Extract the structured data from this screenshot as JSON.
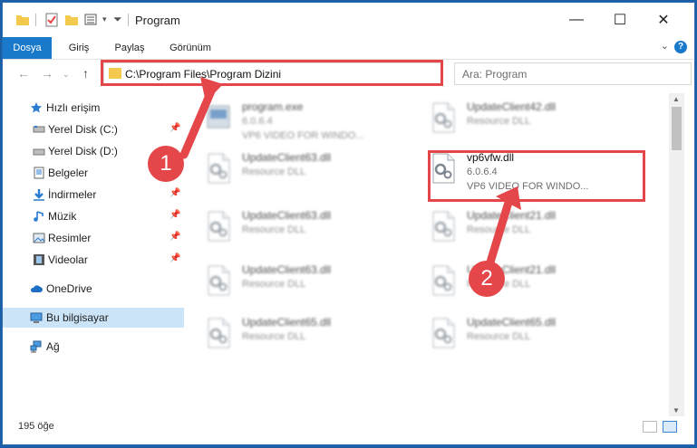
{
  "window": {
    "title": "Program"
  },
  "ribbon": {
    "tabs": [
      "Dosya",
      "Giriş",
      "Paylaş",
      "Görünüm"
    ]
  },
  "address_bar": {
    "path": "C:\\Program Files\\Program Dizini"
  },
  "search": {
    "placeholder": "Ara: Program"
  },
  "sidebar": {
    "items": [
      {
        "label": "Hızlı erişim",
        "icon": "star-icon",
        "pinned": false
      },
      {
        "label": "Yerel Disk (C:)",
        "icon": "drive-icon",
        "pinned": true
      },
      {
        "label": "Yerel Disk (D:)",
        "icon": "drive-icon",
        "pinned": false
      },
      {
        "label": "Belgeler",
        "icon": "documents-icon",
        "pinned": true
      },
      {
        "label": "İndirmeler",
        "icon": "downloads-icon",
        "pinned": true
      },
      {
        "label": "Müzik",
        "icon": "music-icon",
        "pinned": true
      },
      {
        "label": "Resimler",
        "icon": "pictures-icon",
        "pinned": true
      },
      {
        "label": "Videolar",
        "icon": "videos-icon",
        "pinned": true
      },
      {
        "label": "OneDrive",
        "icon": "cloud-icon",
        "pinned": false
      },
      {
        "label": "Bu bilgisayar",
        "icon": "computer-icon",
        "pinned": false,
        "selected": true
      },
      {
        "label": "Ağ",
        "icon": "network-icon",
        "pinned": false
      }
    ]
  },
  "files": [
    {
      "name": "program.exe",
      "line2": "6.0.6.4",
      "line3": "VP6 VIDEO FOR WINDO...",
      "blurred": true,
      "icon": "exe-icon"
    },
    {
      "name": "UpdateClient42.dll",
      "line2": "Resource DLL",
      "line3": "",
      "blurred": true,
      "icon": "dll-icon"
    },
    {
      "name": "UpdateClient63.dll",
      "line2": "Resource DLL",
      "line3": "",
      "blurred": true,
      "icon": "dll-icon"
    },
    {
      "name": "vp6vfw.dll",
      "line2": "6.0.6.4",
      "line3": "VP6 VIDEO FOR WINDO...",
      "blurred": false,
      "icon": "dll-icon"
    },
    {
      "name": "UpdateClient63.dll",
      "line2": "Resource DLL",
      "line3": "",
      "blurred": true,
      "icon": "dll-icon"
    },
    {
      "name": "UpdateClient21.dll",
      "line2": "Resource DLL",
      "line3": "",
      "blurred": true,
      "icon": "dll-icon"
    },
    {
      "name": "UpdateClient63.dll",
      "line2": "Resource DLL",
      "line3": "",
      "blurred": true,
      "icon": "dll-icon"
    },
    {
      "name": "UpdateClient21.dll",
      "line2": "Resource DLL",
      "line3": "",
      "blurred": true,
      "icon": "dll-icon"
    },
    {
      "name": "UpdateClient65.dll",
      "line2": "Resource DLL",
      "line3": "",
      "blurred": true,
      "icon": "dll-icon"
    },
    {
      "name": "UpdateClient65.dll",
      "line2": "Resource DLL",
      "line3": "",
      "blurred": true,
      "icon": "dll-icon"
    }
  ],
  "status": {
    "item_count": "195 öğe"
  },
  "annotations": {
    "marker1": "1",
    "marker2": "2",
    "color": "#e4464a"
  }
}
